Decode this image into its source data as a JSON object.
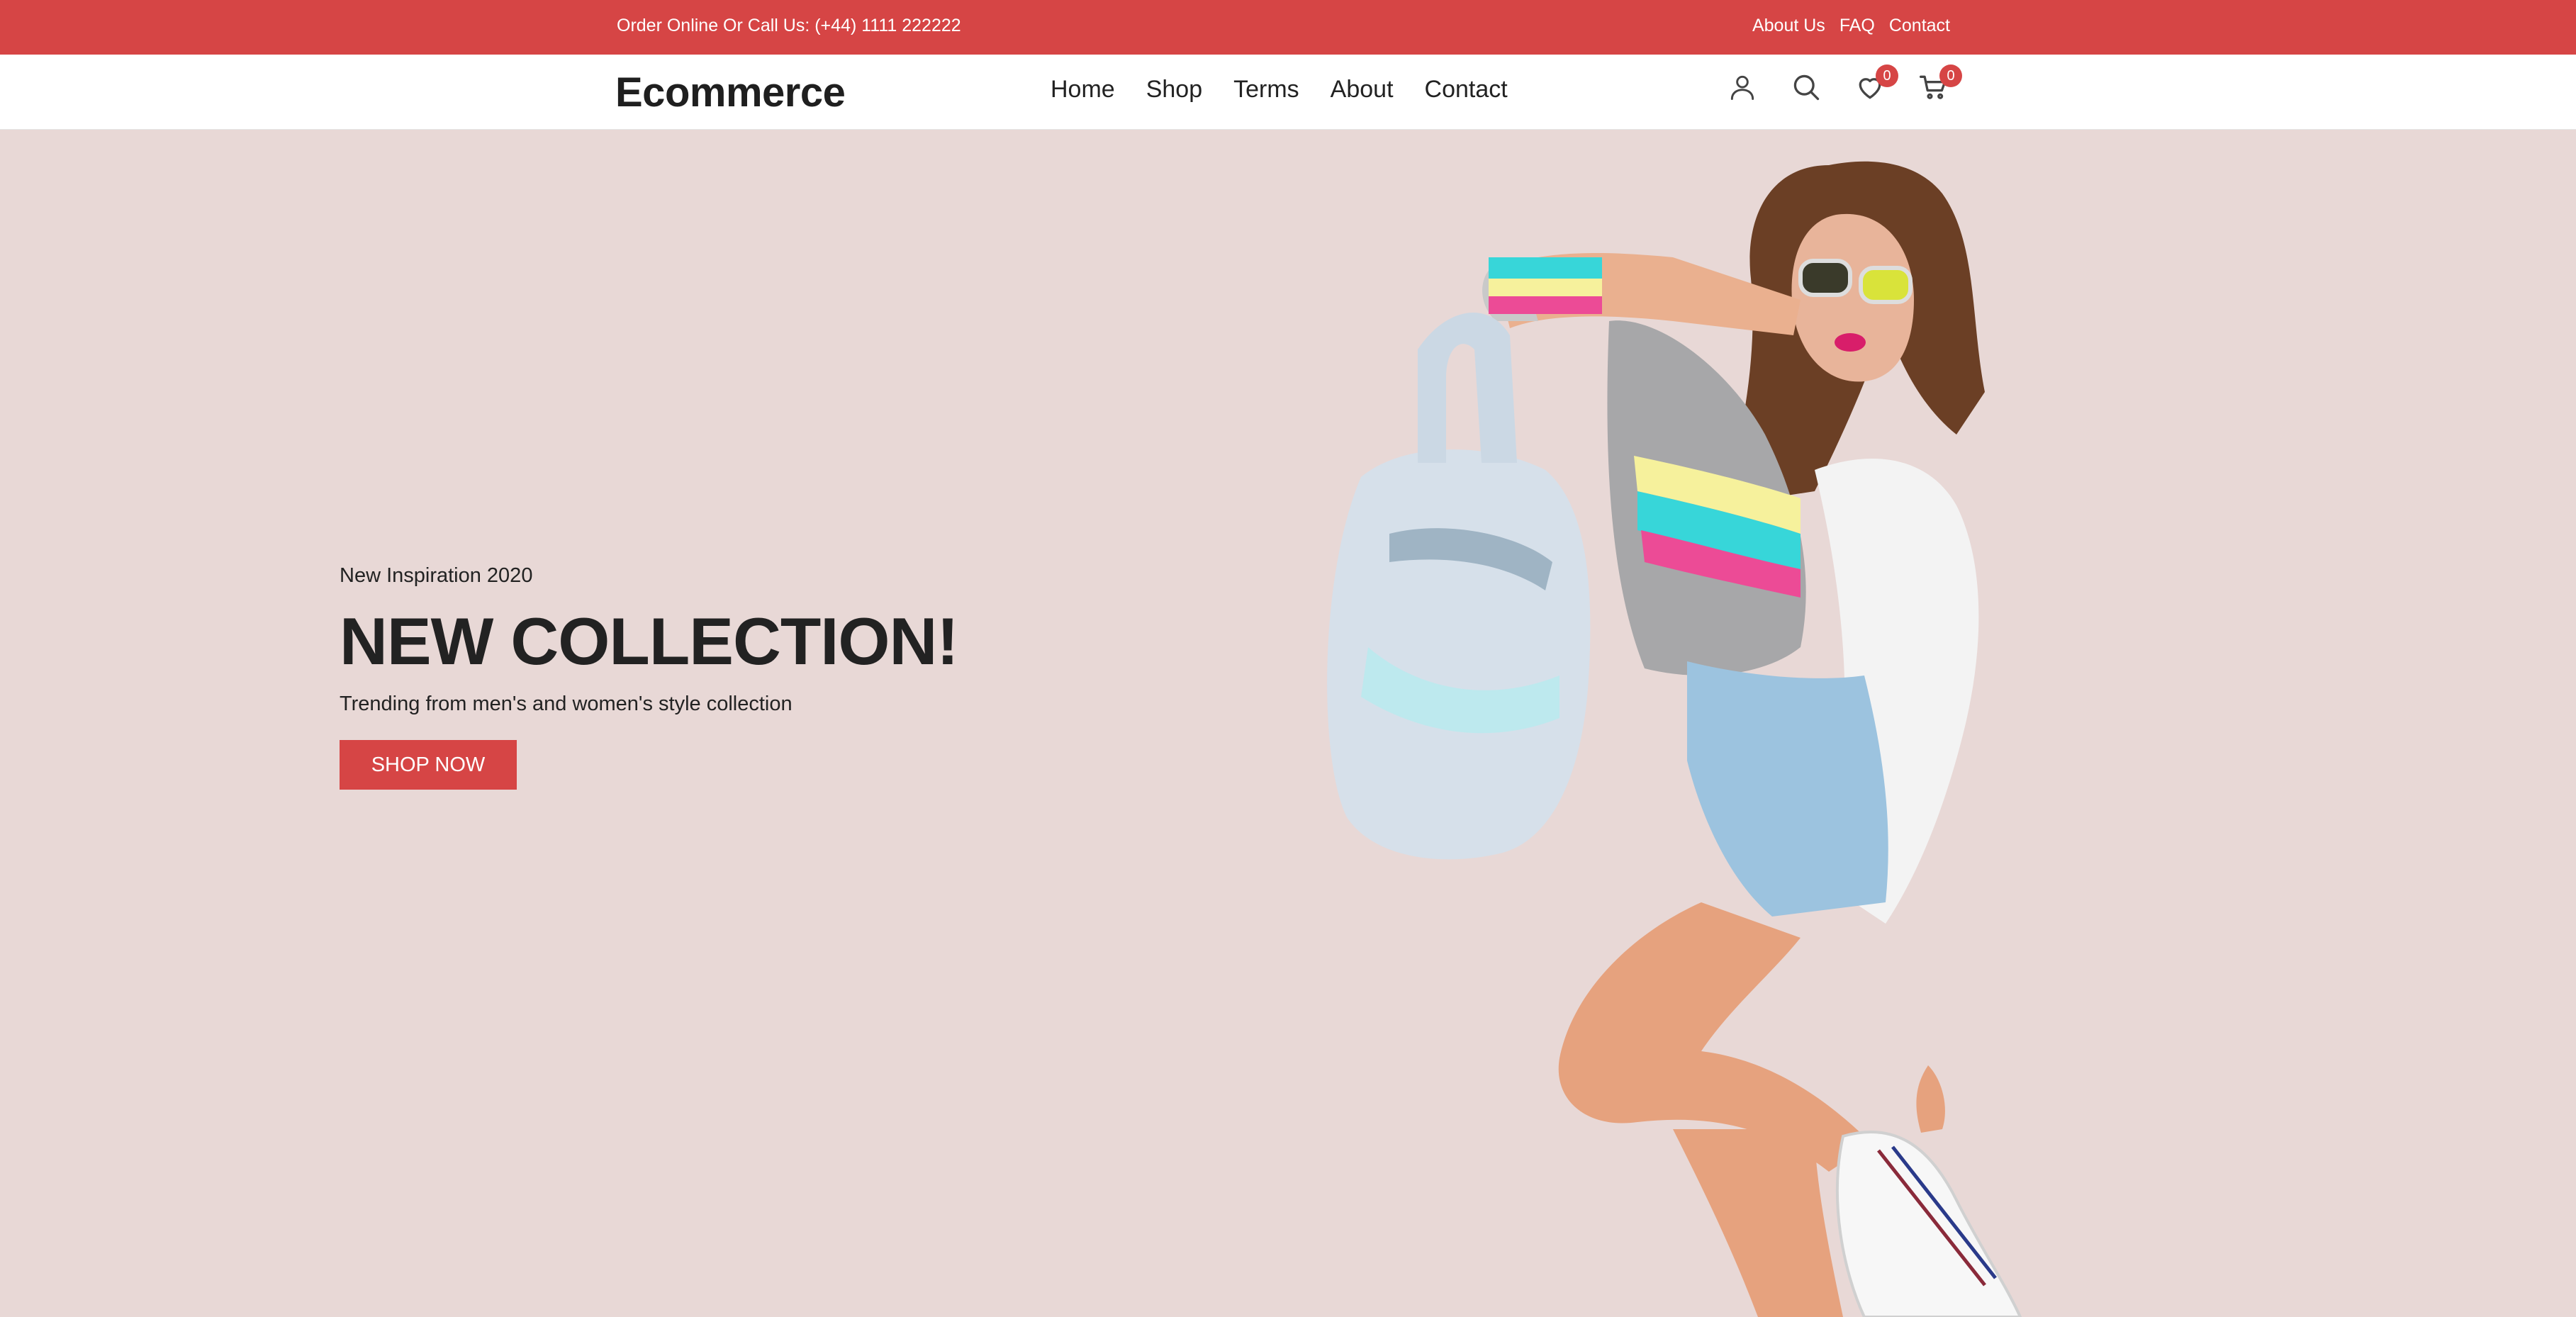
{
  "topbar": {
    "phone_text": "Order Online Or Call Us: (+44) 1111 222222",
    "links": [
      "About Us",
      "FAQ",
      "Contact"
    ]
  },
  "header": {
    "logo": "Ecommerce",
    "nav": [
      "Home",
      "Shop",
      "Terms",
      "About",
      "Contact"
    ],
    "icons": [
      "user-icon",
      "search-icon",
      "heart-icon",
      "cart-icon"
    ],
    "wishlist_count": "0",
    "cart_count": "0"
  },
  "hero": {
    "subtitle": "New Inspiration 2020",
    "headline": "NEW COLLECTION!",
    "tagline": "Trending from men's and women's style collection",
    "cta_label": "SHOP NOW"
  },
  "colors": {
    "accent": "#d64545",
    "hero_background": "#e8d8d6"
  }
}
